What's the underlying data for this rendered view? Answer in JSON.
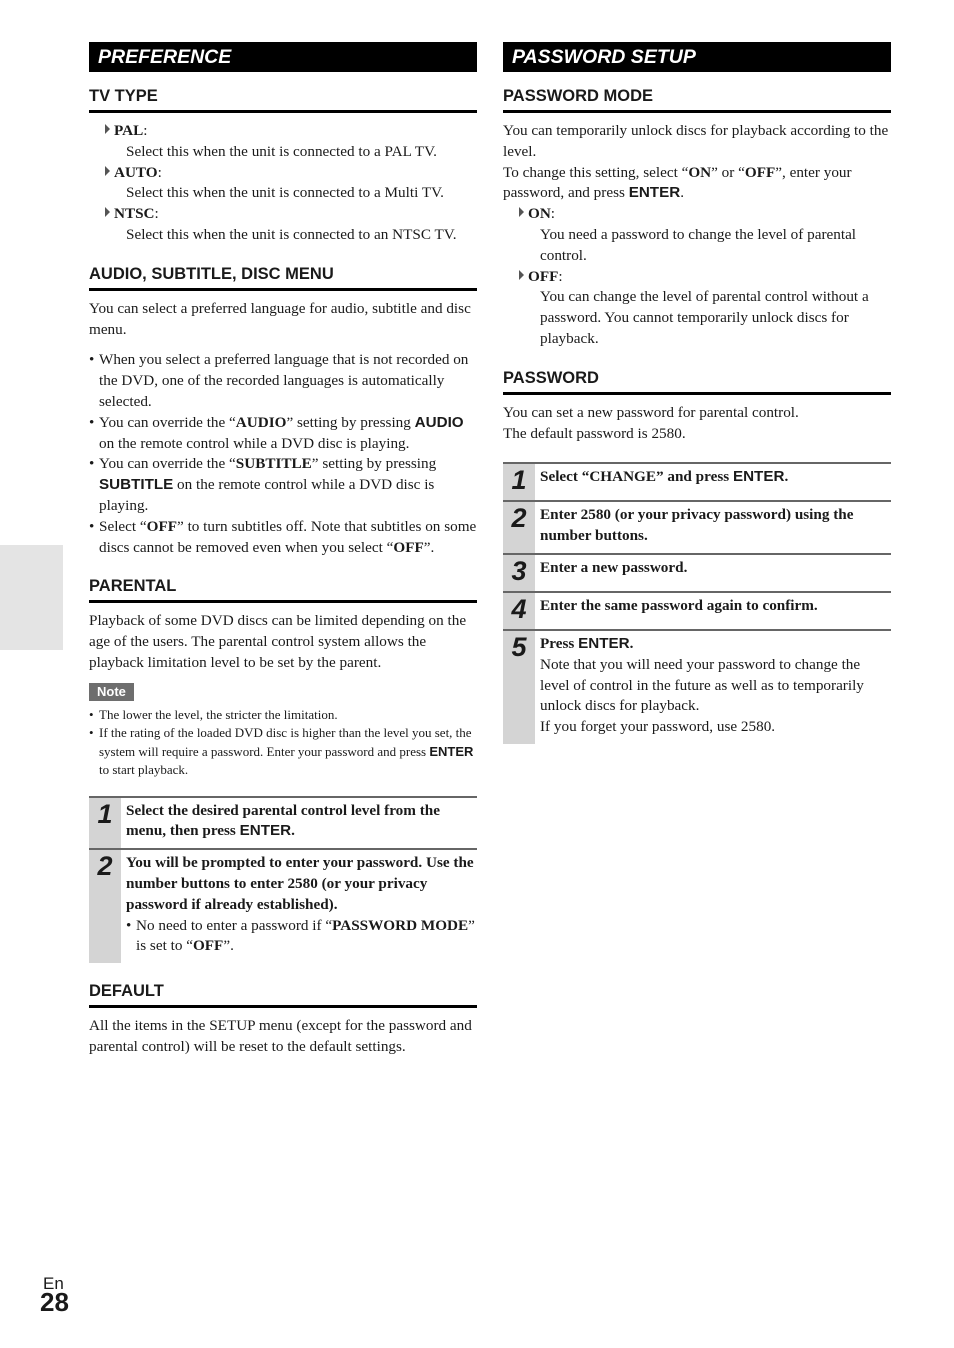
{
  "page": {
    "language": "En",
    "number": "28"
  },
  "left": {
    "banner": "PREFERENCE",
    "tv_type": {
      "heading": "TV TYPE",
      "options": [
        {
          "label": "PAL",
          "desc": "Select this when the unit is connected to a PAL TV."
        },
        {
          "label": "AUTO",
          "desc": "Select this when the unit is connected to a Multi TV."
        },
        {
          "label": "NTSC",
          "desc": "Select this when the unit is connected to an NTSC TV."
        }
      ]
    },
    "audio": {
      "heading": "AUDIO, SUBTITLE, DISC MENU",
      "intro": "You can select a preferred language for audio, subtitle and disc menu.",
      "b1": "When you select a preferred language that is not recorded on the DVD, one of the recorded languages is automatically selected.",
      "b2_pre": "You can override the “",
      "b2_bold": "AUDIO",
      "b2_mid": "” setting by pressing ",
      "b2_key": "AUDIO",
      "b2_post": " on the remote control while a DVD disc is playing.",
      "b3_pre": "You can override the “",
      "b3_bold": "SUBTITLE",
      "b3_mid": "” setting by pressing ",
      "b3_key": "SUBTITLE",
      "b3_post": " on the remote control while a DVD disc is playing.",
      "b4_pre": "Select “",
      "b4_bold": "OFF",
      "b4_mid": "” to turn subtitles off. Note that subtitles on some discs cannot be removed even when you select “",
      "b4_bold2": "OFF",
      "b4_post": "”."
    },
    "parental": {
      "heading": "PARENTAL",
      "intro": "Playback of some DVD discs can be limited depending on the age of the users. The parental control system allows the playback limitation level to be set by the parent.",
      "note_label": "Note",
      "note1": "The lower the level, the stricter the limitation.",
      "note2_pre": "If the rating of the loaded DVD disc is higher than the level you set, the system will require a password. Enter your password and press ",
      "note2_key": "ENTER",
      "note2_post": " to start playback.",
      "steps": [
        {
          "num": "1",
          "title_pre": "Select the desired parental control level from the menu, then press ",
          "title_key": "ENTER",
          "title_post": "."
        },
        {
          "num": "2",
          "title": "You will be prompted to enter your password. Use the number buttons to enter 2580 (or your privacy password if already established).",
          "sub_pre": "No need to enter a password if “",
          "sub_bold": "PASSWORD MODE",
          "sub_mid": "” is set to “",
          "sub_bold2": "OFF",
          "sub_post": "”."
        }
      ]
    },
    "default": {
      "heading": "DEFAULT",
      "text": "All the items in the SETUP menu (except for the password and parental control) will be reset to the default settings."
    }
  },
  "right": {
    "banner": "PASSWORD SETUP",
    "mode": {
      "heading": "PASSWORD MODE",
      "p1": "You can temporarily unlock discs for playback according to the level.",
      "p2_pre": "To change this setting, select “",
      "p2_on": "ON",
      "p2_mid": "” or “",
      "p2_off": "OFF",
      "p2_mid2": "”, enter your password, and press ",
      "p2_key": "ENTER",
      "p2_post": ".",
      "options": [
        {
          "label": "ON",
          "desc": "You need a password to change the level of parental control."
        },
        {
          "label": "OFF",
          "desc": "You can change the level of parental control without a password. You cannot temporarily unlock discs for playback."
        }
      ]
    },
    "password": {
      "heading": "PASSWORD",
      "p1": "You can set a new password for parental control.",
      "p2": "The default password is 2580.",
      "steps": [
        {
          "num": "1",
          "title_pre": "Select “CHANGE” and press ",
          "title_key": "ENTER",
          "title_post": "."
        },
        {
          "num": "2",
          "title": "Enter 2580 (or your privacy password) using the number buttons."
        },
        {
          "num": "3",
          "title": "Enter a new password."
        },
        {
          "num": "4",
          "title": "Enter the same password again to confirm."
        },
        {
          "num": "5",
          "title_pre": "Press ",
          "title_key": "ENTER",
          "title_post": ".",
          "body1": "Note that you will need your password to change the level of control in the future as well as to temporarily unlock discs for playback.",
          "body2": "If you forget your password, use 2580."
        }
      ]
    }
  }
}
